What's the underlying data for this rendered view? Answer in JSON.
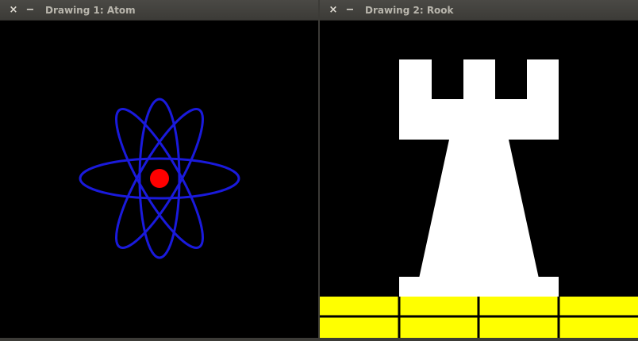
{
  "windows": [
    {
      "title": "Drawing 1: Atom",
      "close_glyph": "×",
      "minimize_glyph": "−",
      "drawing": {
        "subject": "atom",
        "nucleus_color": "#ff0000",
        "orbit_color": "#1a1adc",
        "background": "#000000"
      }
    },
    {
      "title": "Drawing 2: Rook",
      "close_glyph": "×",
      "minimize_glyph": "−",
      "drawing": {
        "subject": "rook",
        "piece_color": "#ffffff",
        "board_color": "#ffff00",
        "board_lines_color": "#000000",
        "background": "#000000"
      }
    }
  ]
}
